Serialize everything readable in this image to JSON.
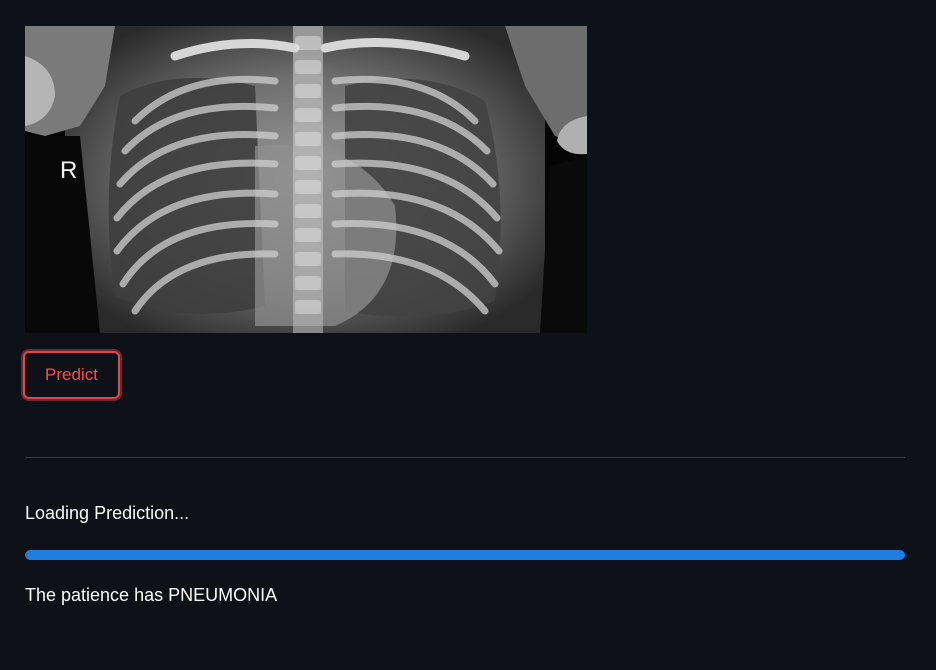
{
  "image": {
    "marker_letter": "R"
  },
  "predict_button": {
    "label": "Predict"
  },
  "status": {
    "loading_label": "Loading Prediction...",
    "progress_fraction": 1.0,
    "result": "The patience has PNEUMONIA"
  },
  "colors": {
    "background": "#0e1117",
    "accent_red": "#ff4b4b",
    "progress_blue": "#1e7fe0"
  }
}
